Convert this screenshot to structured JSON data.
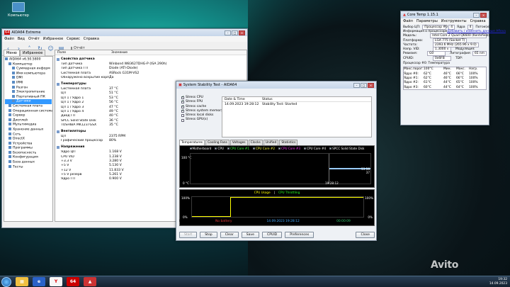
{
  "desktop": {
    "icon_label": "Компьютер"
  },
  "aida": {
    "title": "AIDA64 Extreme",
    "menu": [
      "Файл",
      "Вид",
      "Отчёт",
      "Избранное",
      "Сервис",
      "Справка"
    ],
    "toolbar_report": "Отчёт",
    "tabs": [
      "Меню",
      "Избранное"
    ],
    "tree": [
      {
        "label": "AIDA64 v6.50.5800",
        "indent": 0
      },
      {
        "label": "Компьютер",
        "indent": 1
      },
      {
        "label": "Суммарная информ",
        "indent": 2
      },
      {
        "label": "Имя компьютера",
        "indent": 2
      },
      {
        "label": "DMI",
        "indent": 2
      },
      {
        "label": "IPMI",
        "indent": 2
      },
      {
        "label": "Разгон",
        "indent": 2
      },
      {
        "label": "Электропитание",
        "indent": 2
      },
      {
        "label": "Портативный ПК",
        "indent": 2
      },
      {
        "label": "Датчики",
        "indent": 2,
        "selected": true
      },
      {
        "label": "Системная плата",
        "indent": 1
      },
      {
        "label": "Операционная система",
        "indent": 1
      },
      {
        "label": "Сервер",
        "indent": 1
      },
      {
        "label": "Дисплей",
        "indent": 1
      },
      {
        "label": "Мультимедиа",
        "indent": 1
      },
      {
        "label": "Хранение данных",
        "indent": 1
      },
      {
        "label": "Сеть",
        "indent": 1
      },
      {
        "label": "DirectX",
        "indent": 1
      },
      {
        "label": "Устройства",
        "indent": 1
      },
      {
        "label": "Программы",
        "indent": 1
      },
      {
        "label": "Безопасность",
        "indent": 1
      },
      {
        "label": "Конфигурация",
        "indent": 1
      },
      {
        "label": "База данных",
        "indent": 1
      },
      {
        "label": "Тесты",
        "indent": 1
      }
    ],
    "col_field": "Поле",
    "col_value": "Значение",
    "groups": [
      {
        "title": "Свойства датчика",
        "rows": [
          {
            "f": "Тип датчика",
            "v": "Winbond W83627DHG-P  (ISA 290h)"
          },
          {
            "f": "Тип датчика ГП",
            "v": "Diode  (ATI-Diode)"
          },
          {
            "f": "Системная плата",
            "v": "ASRock G31M-VS2"
          },
          {
            "f": "Обнаружено вскрытие корп...",
            "v": "Да"
          }
        ]
      },
      {
        "title": "Температуры",
        "rows": [
          {
            "f": "Системная плата",
            "v": "37 °C"
          },
          {
            "f": "ЦП",
            "v": "51 °C"
          },
          {
            "f": "ЦП 1 / Ядро 1",
            "v": "53 °C"
          },
          {
            "f": "ЦП 1 / Ядро 2",
            "v": "56 °C"
          },
          {
            "f": "ЦП 1 / Ядро 3",
            "v": "47 °C"
          },
          {
            "f": "ЦП 1 / Ядро 4",
            "v": "49 °C"
          },
          {
            "f": "Диод ГП",
            "v": "40 °C"
          },
          {
            "f": "SPCC Solid State Disk",
            "v": "36 °C"
          },
          {
            "f": "TOSHIBA MK1237GSX",
            "v": "35 °C"
          }
        ]
      },
      {
        "title": "Вентиляторы",
        "rows": [
          {
            "f": "ЦП",
            "v": "2375 RPM"
          },
          {
            "f": "Графический процессор",
            "v": "80%"
          }
        ]
      },
      {
        "title": "Напряжения",
        "rows": [
          {
            "f": "Ядро ЦП",
            "v": "1.168 V"
          },
          {
            "f": "CPU VID",
            "v": "1.238 V"
          },
          {
            "f": "+3.3 V",
            "v": "3.280 V"
          },
          {
            "f": "+5 V",
            "v": "5.130 V"
          },
          {
            "f": "+12 V",
            "v": "11.833 V"
          },
          {
            "f": "+5 V резерв",
            "v": "5.261 V"
          },
          {
            "f": "Ядро ГП",
            "v": "0.900 V"
          }
        ]
      }
    ]
  },
  "stab": {
    "title": "System Stability Test - AIDA64",
    "stress": [
      {
        "label": "Stress CPU",
        "on": true
      },
      {
        "label": "Stress FPU",
        "on": true
      },
      {
        "label": "Stress cache",
        "on": true
      },
      {
        "label": "Stress system memory",
        "on": true
      },
      {
        "label": "Stress local disks",
        "on": false
      },
      {
        "label": "Stress GPU(s)",
        "on": false
      }
    ],
    "col_date": "Date & Time",
    "col_status": "Status",
    "event_date": "14.09.2023 19:28:12",
    "event_status": "Stability Test: Started",
    "tabs": [
      "Temperatures",
      "Cooling Fans",
      "Voltages",
      "Clocks",
      "Unified",
      "Statistics"
    ],
    "temp_legend": [
      "Motherboard",
      "CPU",
      "CPU Core #1",
      "CPU Core #2",
      "CPU Core #3",
      "CPU Core #4",
      "SPCC Solid State Disk"
    ],
    "temp_top": "100 °C",
    "temp_bottom": "0 °C",
    "temp_time": "19:28:12",
    "temp_right": "53 56",
    "temp_right2": "37",
    "usage_legend1": "CPU Usage",
    "usage_sep": "|",
    "usage_legend2": "CPU Throttling",
    "usage_top": "100%",
    "usage_bottom": "0%",
    "usage_right_top": "100%",
    "usage_right_bottom": "0%",
    "battery_label": "Remaining Battery:",
    "battery_value": "No battery",
    "started_label": "Test Started:",
    "started_value": "14.09.2023 19:28:12",
    "elapsed_label": "Elapsed Time:",
    "elapsed_value": "00:00:09",
    "buttons": [
      "Start",
      "Stop",
      "Clear",
      "Save",
      "CPUID",
      "Preferences",
      "Close"
    ],
    "temp_level": 0.52,
    "usage_level": 1.0
  },
  "coretemp": {
    "title": "Core Temp 1.15.1",
    "menu": [
      "Файл",
      "Параметры",
      "Инструменты",
      "Справка"
    ],
    "select_label": "Выбор ЦП:",
    "select_value": "Процессор #0",
    "cores": "4",
    "cores_label": "Ядра",
    "threads": "4",
    "threads_label": "Поток(и)",
    "info_label": "Информация о процессоре",
    "info_link": "Добавить / изменить данные Aflexa",
    "rows": [
      {
        "k": "Модель:",
        "v": "Intel Core 2 Quad Q6600 (Kentsfield)"
      },
      {
        "k": "Платформа:",
        "v": "LGA 775 (Socket T)"
      },
      {
        "k": "Частота:",
        "v": "2393.6 MHz (265.96 x 9.0)"
      },
      {
        "k": "Напр. VID:",
        "v": "1.3000 v",
        "extra": "Модуляция:"
      },
      {
        "k": "Ревизия:",
        "v": "G0",
        "extra": "Литография:",
        "extra_v": "65 nm"
      },
      {
        "k": "CPUID:",
        "v": "0x6FB",
        "extra": "TDP:"
      }
    ],
    "proc_label": "Процессор #0: Температура",
    "head": [
      "Макс.порог:",
      "100°C",
      "Мин.",
      "Макс.",
      "Нагр."
    ],
    "temps": [
      {
        "k": "Ядро #0:",
        "v": "62°C",
        "min": "46°C",
        "max": "66°C",
        "load": "100%"
      },
      {
        "k": "Ядро #1:",
        "v": "62°C",
        "min": "46°C",
        "max": "66°C",
        "load": "100%"
      },
      {
        "k": "Ядро #2:",
        "v": "61°C",
        "min": "44°C",
        "max": "65°C",
        "load": "100%"
      },
      {
        "k": "Ядро #3:",
        "v": "60°C",
        "min": "44°C",
        "max": "64°C",
        "load": "100%"
      }
    ]
  },
  "taskbar": {
    "time": "19:32",
    "date": "14.09.2023",
    "aida_label": "64"
  },
  "watermark": "Avito"
}
